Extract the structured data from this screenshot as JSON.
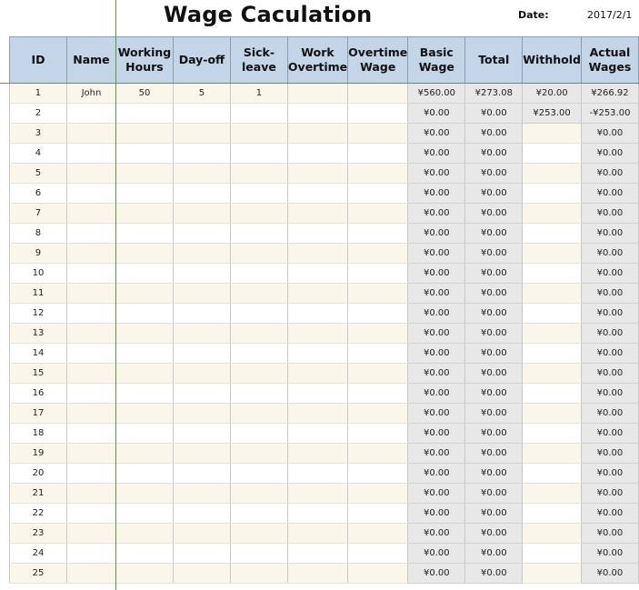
{
  "title": "Wage Caculation",
  "date": {
    "label": "Date:",
    "value": "2017/2/1"
  },
  "columns": [
    {
      "key": "id",
      "label1": "ID",
      "label2": ""
    },
    {
      "key": "name",
      "label1": "Name",
      "label2": ""
    },
    {
      "key": "working_hours",
      "label1": "Working",
      "label2": "Hours"
    },
    {
      "key": "day_off",
      "label1": "Day-off",
      "label2": ""
    },
    {
      "key": "sick_leave",
      "label1": "Sick-",
      "label2": "leave"
    },
    {
      "key": "work_overtime",
      "label1": "Work",
      "label2": "Overtime"
    },
    {
      "key": "overtime_wage",
      "label1": "Overtime",
      "label2": "Wage"
    },
    {
      "key": "basic_wage",
      "label1": "Basic",
      "label2": "Wage"
    },
    {
      "key": "total",
      "label1": "Total",
      "label2": ""
    },
    {
      "key": "withhold",
      "label1": "Withhold",
      "label2": ""
    },
    {
      "key": "actual_wages",
      "label1": "Actual",
      "label2": "Wages"
    }
  ],
  "rows": [
    {
      "id": "1",
      "name": "John",
      "working_hours": "50",
      "day_off": "5",
      "sick_leave": "1",
      "work_overtime": "",
      "overtime_wage": "",
      "basic_wage": "¥560.00",
      "total": "¥273.08",
      "withhold": "¥20.00",
      "actual_wages": "¥266.92"
    },
    {
      "id": "2",
      "name": "",
      "working_hours": "",
      "day_off": "",
      "sick_leave": "",
      "work_overtime": "",
      "overtime_wage": "",
      "basic_wage": "¥0.00",
      "total": "¥0.00",
      "withhold": "¥253.00",
      "actual_wages": "-¥253.00"
    },
    {
      "id": "3",
      "name": "",
      "working_hours": "",
      "day_off": "",
      "sick_leave": "",
      "work_overtime": "",
      "overtime_wage": "",
      "basic_wage": "¥0.00",
      "total": "¥0.00",
      "withhold": "",
      "actual_wages": "¥0.00"
    },
    {
      "id": "4",
      "name": "",
      "working_hours": "",
      "day_off": "",
      "sick_leave": "",
      "work_overtime": "",
      "overtime_wage": "",
      "basic_wage": "¥0.00",
      "total": "¥0.00",
      "withhold": "",
      "actual_wages": "¥0.00"
    },
    {
      "id": "5",
      "name": "",
      "working_hours": "",
      "day_off": "",
      "sick_leave": "",
      "work_overtime": "",
      "overtime_wage": "",
      "basic_wage": "¥0.00",
      "total": "¥0.00",
      "withhold": "",
      "actual_wages": "¥0.00"
    },
    {
      "id": "6",
      "name": "",
      "working_hours": "",
      "day_off": "",
      "sick_leave": "",
      "work_overtime": "",
      "overtime_wage": "",
      "basic_wage": "¥0.00",
      "total": "¥0.00",
      "withhold": "",
      "actual_wages": "¥0.00"
    },
    {
      "id": "7",
      "name": "",
      "working_hours": "",
      "day_off": "",
      "sick_leave": "",
      "work_overtime": "",
      "overtime_wage": "",
      "basic_wage": "¥0.00",
      "total": "¥0.00",
      "withhold": "",
      "actual_wages": "¥0.00"
    },
    {
      "id": "8",
      "name": "",
      "working_hours": "",
      "day_off": "",
      "sick_leave": "",
      "work_overtime": "",
      "overtime_wage": "",
      "basic_wage": "¥0.00",
      "total": "¥0.00",
      "withhold": "",
      "actual_wages": "¥0.00"
    },
    {
      "id": "9",
      "name": "",
      "working_hours": "",
      "day_off": "",
      "sick_leave": "",
      "work_overtime": "",
      "overtime_wage": "",
      "basic_wage": "¥0.00",
      "total": "¥0.00",
      "withhold": "",
      "actual_wages": "¥0.00"
    },
    {
      "id": "10",
      "name": "",
      "working_hours": "",
      "day_off": "",
      "sick_leave": "",
      "work_overtime": "",
      "overtime_wage": "",
      "basic_wage": "¥0.00",
      "total": "¥0.00",
      "withhold": "",
      "actual_wages": "¥0.00"
    },
    {
      "id": "11",
      "name": "",
      "working_hours": "",
      "day_off": "",
      "sick_leave": "",
      "work_overtime": "",
      "overtime_wage": "",
      "basic_wage": "¥0.00",
      "total": "¥0.00",
      "withhold": "",
      "actual_wages": "¥0.00"
    },
    {
      "id": "12",
      "name": "",
      "working_hours": "",
      "day_off": "",
      "sick_leave": "",
      "work_overtime": "",
      "overtime_wage": "",
      "basic_wage": "¥0.00",
      "total": "¥0.00",
      "withhold": "",
      "actual_wages": "¥0.00"
    },
    {
      "id": "13",
      "name": "",
      "working_hours": "",
      "day_off": "",
      "sick_leave": "",
      "work_overtime": "",
      "overtime_wage": "",
      "basic_wage": "¥0.00",
      "total": "¥0.00",
      "withhold": "",
      "actual_wages": "¥0.00"
    },
    {
      "id": "14",
      "name": "",
      "working_hours": "",
      "day_off": "",
      "sick_leave": "",
      "work_overtime": "",
      "overtime_wage": "",
      "basic_wage": "¥0.00",
      "total": "¥0.00",
      "withhold": "",
      "actual_wages": "¥0.00"
    },
    {
      "id": "15",
      "name": "",
      "working_hours": "",
      "day_off": "",
      "sick_leave": "",
      "work_overtime": "",
      "overtime_wage": "",
      "basic_wage": "¥0.00",
      "total": "¥0.00",
      "withhold": "",
      "actual_wages": "¥0.00"
    },
    {
      "id": "16",
      "name": "",
      "working_hours": "",
      "day_off": "",
      "sick_leave": "",
      "work_overtime": "",
      "overtime_wage": "",
      "basic_wage": "¥0.00",
      "total": "¥0.00",
      "withhold": "",
      "actual_wages": "¥0.00"
    },
    {
      "id": "17",
      "name": "",
      "working_hours": "",
      "day_off": "",
      "sick_leave": "",
      "work_overtime": "",
      "overtime_wage": "",
      "basic_wage": "¥0.00",
      "total": "¥0.00",
      "withhold": "",
      "actual_wages": "¥0.00"
    },
    {
      "id": "18",
      "name": "",
      "working_hours": "",
      "day_off": "",
      "sick_leave": "",
      "work_overtime": "",
      "overtime_wage": "",
      "basic_wage": "¥0.00",
      "total": "¥0.00",
      "withhold": "",
      "actual_wages": "¥0.00"
    },
    {
      "id": "19",
      "name": "",
      "working_hours": "",
      "day_off": "",
      "sick_leave": "",
      "work_overtime": "",
      "overtime_wage": "",
      "basic_wage": "¥0.00",
      "total": "¥0.00",
      "withhold": "",
      "actual_wages": "¥0.00"
    },
    {
      "id": "20",
      "name": "",
      "working_hours": "",
      "day_off": "",
      "sick_leave": "",
      "work_overtime": "",
      "overtime_wage": "",
      "basic_wage": "¥0.00",
      "total": "¥0.00",
      "withhold": "",
      "actual_wages": "¥0.00"
    },
    {
      "id": "21",
      "name": "",
      "working_hours": "",
      "day_off": "",
      "sick_leave": "",
      "work_overtime": "",
      "overtime_wage": "",
      "basic_wage": "¥0.00",
      "total": "¥0.00",
      "withhold": "",
      "actual_wages": "¥0.00"
    },
    {
      "id": "22",
      "name": "",
      "working_hours": "",
      "day_off": "",
      "sick_leave": "",
      "work_overtime": "",
      "overtime_wage": "",
      "basic_wage": "¥0.00",
      "total": "¥0.00",
      "withhold": "",
      "actual_wages": "¥0.00"
    },
    {
      "id": "23",
      "name": "",
      "working_hours": "",
      "day_off": "",
      "sick_leave": "",
      "work_overtime": "",
      "overtime_wage": "",
      "basic_wage": "¥0.00",
      "total": "¥0.00",
      "withhold": "",
      "actual_wages": "¥0.00"
    },
    {
      "id": "24",
      "name": "",
      "working_hours": "",
      "day_off": "",
      "sick_leave": "",
      "work_overtime": "",
      "overtime_wage": "",
      "basic_wage": "¥0.00",
      "total": "¥0.00",
      "withhold": "",
      "actual_wages": "¥0.00"
    },
    {
      "id": "25",
      "name": "",
      "working_hours": "",
      "day_off": "",
      "sick_leave": "",
      "work_overtime": "",
      "overtime_wage": "",
      "basic_wage": "¥0.00",
      "total": "¥0.00",
      "withhold": "",
      "actual_wages": "¥0.00"
    }
  ],
  "colors": {
    "header_bg": "#c5d5e8",
    "row_alt_bg": "#faf6ea",
    "calc_bg": "#e8e8e8",
    "freeze_line": "#5a9a3a"
  }
}
